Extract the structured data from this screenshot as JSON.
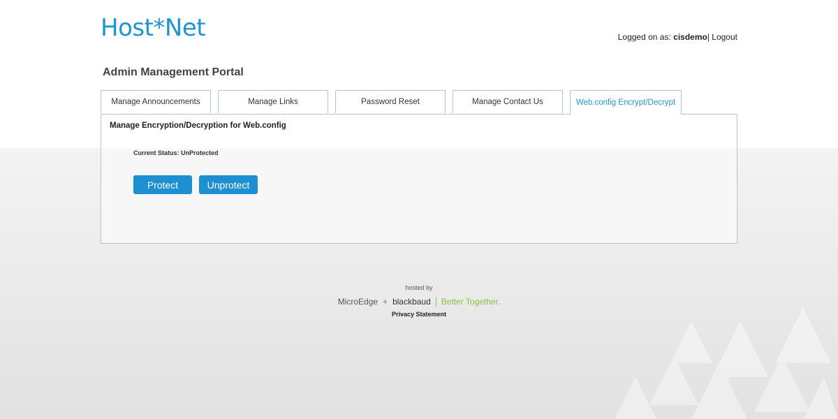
{
  "header": {
    "logo_text": "Host*Net",
    "logged_on_prefix": "Logged on as: ",
    "username": "cisdemo",
    "separator": "|",
    "logout_label": " Logout"
  },
  "portal_title": "Admin Management Portal",
  "tabs": [
    {
      "label": "Manage Announcements",
      "active": false
    },
    {
      "label": "Manage Links",
      "active": false
    },
    {
      "label": "Password Reset",
      "active": false
    },
    {
      "label": "Manage Contact Us",
      "active": false
    },
    {
      "label": "Web.config Encrypt/Decrypt",
      "active": true
    }
  ],
  "panel": {
    "title": "Manage Encryption/Decryption for Web.config",
    "status_text": "Current Status: UnProtected",
    "protect_label": "Protect",
    "unprotect_label": "Unprotect"
  },
  "footer": {
    "hosted_by": "hosted by",
    "brand_1": "MicroEdge",
    "brand_plus": "+",
    "brand_2": "blackbaud",
    "tagline": "Better Together.",
    "privacy": "Privacy Statement"
  },
  "colors": {
    "accent": "#1e95d3",
    "button": "#1e8fd1",
    "tagline": "#8cbf3f"
  }
}
